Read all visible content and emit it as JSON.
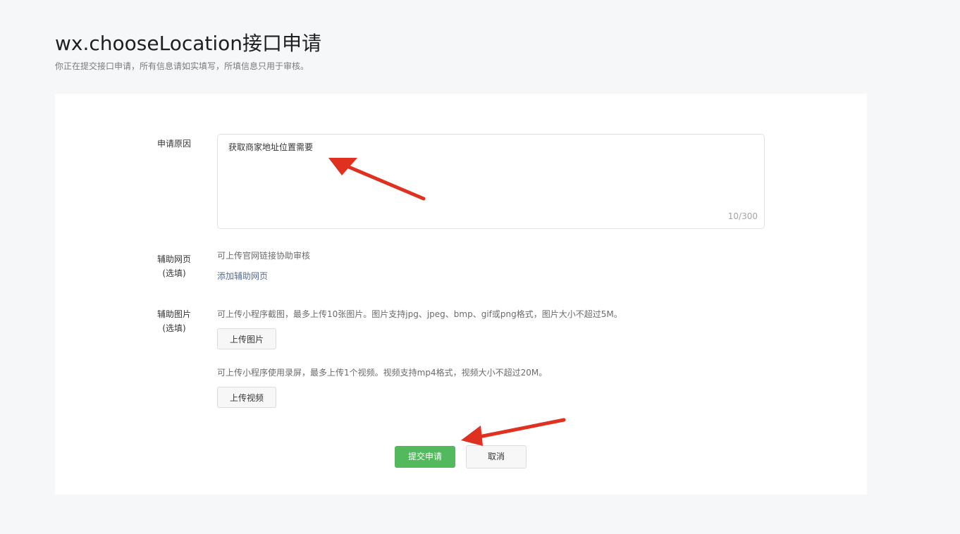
{
  "header": {
    "title": "wx.chooseLocation接口申请",
    "subtitle": "你正在提交接口申请，所有信息请如实填写，所填信息只用于审核。"
  },
  "form": {
    "reason": {
      "label": "申请原因",
      "value": "获取商家地址位置需要",
      "counter": "10/300"
    },
    "webpage": {
      "label": "辅助网页",
      "optional": "(选填)",
      "hint": "可上传官网链接协助审核",
      "add_link": "添加辅助网页"
    },
    "images": {
      "label": "辅助图片",
      "optional": "(选填)",
      "image_hint": "可上传小程序截图，最多上传10张图片。图片支持jpg、jpeg、bmp、gif或png格式，图片大小不超过5M。",
      "upload_image": "上传图片",
      "video_hint": "可上传小程序使用录屏，最多上传1个视频。视频支持mp4格式，视频大小不超过20M。",
      "upload_video": "上传视频"
    }
  },
  "actions": {
    "submit": "提交申请",
    "cancel": "取消"
  },
  "colors": {
    "primary": "#53b95d",
    "link": "#576b95",
    "annotation_arrow": "#e03020"
  }
}
